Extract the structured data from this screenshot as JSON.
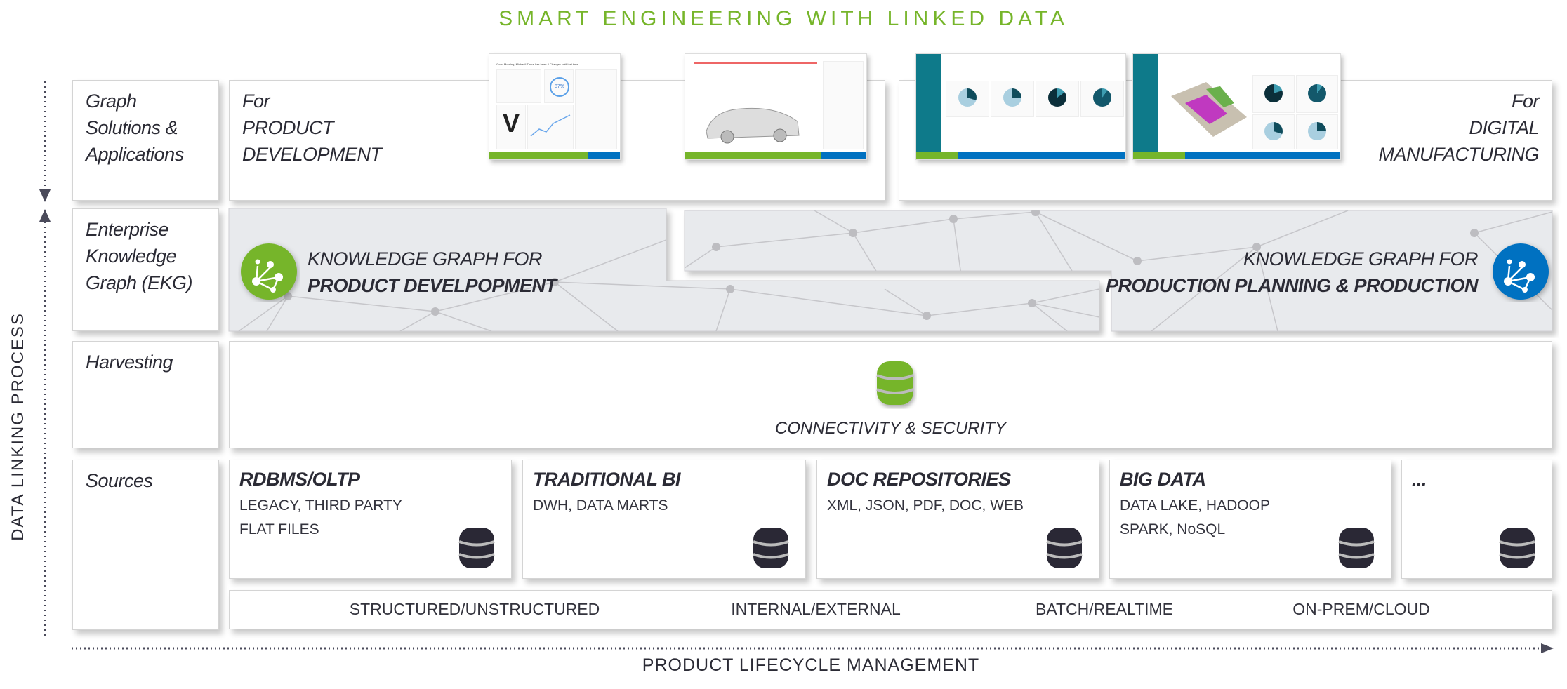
{
  "title": "SMART ENGINEERING WITH LINKED DATA",
  "axes": {
    "vertical": "DATA LINKING PROCESS",
    "horizontal": "PRODUCT LIFECYCLE MANAGEMENT"
  },
  "rows": [
    {
      "label": "Graph Solutions & Applications",
      "label_lines": [
        "Graph",
        "Solutions &",
        "Applications"
      ]
    },
    {
      "label": "Enterprise Knowledge Graph (EKG)",
      "label_lines": [
        "Enterprise",
        "Knowledge",
        "Graph (EKG)"
      ]
    },
    {
      "label": "Harvesting",
      "label_lines": [
        "Harvesting"
      ]
    },
    {
      "label": "Sources",
      "label_lines": [
        "Sources"
      ]
    }
  ],
  "applications": {
    "left": {
      "prefix": "For",
      "lines": [
        "PRODUCT",
        "DEVELOPMENT"
      ]
    },
    "right": {
      "prefix": "For",
      "lines": [
        "DIGITAL",
        "MANUFACTURING"
      ]
    },
    "screenshots": {
      "greeting": "Good Morning, Michael! There has been 4 Changes until last time",
      "gauge": "87%"
    }
  },
  "knowledge_graphs": [
    {
      "line1": "KNOWLEDGE GRAPH FOR",
      "line2": "PRODUCT DEVELPOPMENT",
      "color": "#76b52a"
    },
    {
      "line1": "KNOWLEDGE GRAPH FOR",
      "line2": "PRODUCTION PLANNING & PRODUCTION",
      "color": "#0071c1"
    }
  ],
  "harvesting": {
    "label": "CONNECTIVITY & SECURITY",
    "icon": "database-icon",
    "color": "#76b52a"
  },
  "sources": [
    {
      "title": "RDBMS/OLTP",
      "lines": [
        "LEGACY, THIRD PARTY",
        "FLAT FILES"
      ]
    },
    {
      "title": "TRADITIONAL BI",
      "lines": [
        "DWH, DATA MARTS"
      ]
    },
    {
      "title": "DOC REPOSITORIES",
      "lines": [
        "XML, JSON, PDF, DOC, WEB"
      ]
    },
    {
      "title": "BIG DATA",
      "lines": [
        "DATA LAKE, HADOOP",
        "SPARK, NoSQL"
      ]
    },
    {
      "title": "...",
      "lines": []
    }
  ],
  "source_properties": [
    "STRUCTURED/UNSTRUCTURED",
    "INTERNAL/EXTERNAL",
    "BATCH/REALTIME",
    "ON-PREM/CLOUD"
  ],
  "colors": {
    "accent_green": "#76b52a",
    "accent_blue": "#0071c1",
    "text": "#2b2b35",
    "panel_gray": "#e8eaed"
  }
}
